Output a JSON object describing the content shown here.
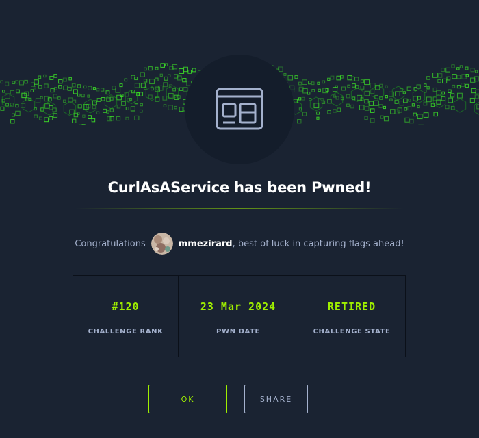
{
  "header": {
    "title": "CurlAsAService has been Pwned!",
    "challenge_icon": "web-browser-icon"
  },
  "congrats": {
    "prefix": "Congratulations",
    "username": "mmezirard",
    "suffix": ", best of luck in capturing flags ahead!"
  },
  "stats": [
    {
      "value": "#120",
      "label": "CHALLENGE RANK"
    },
    {
      "value": "23 Mar 2024",
      "label": "PWN DATE"
    },
    {
      "value": "RETIRED",
      "label": "CHALLENGE STATE"
    }
  ],
  "buttons": {
    "ok_label": "OK",
    "share_label": "SHARE"
  },
  "colors": {
    "background": "#1a2332",
    "panel": "#141d2b",
    "accent_green": "#9fef00",
    "muted_text": "#a4b1cd"
  }
}
